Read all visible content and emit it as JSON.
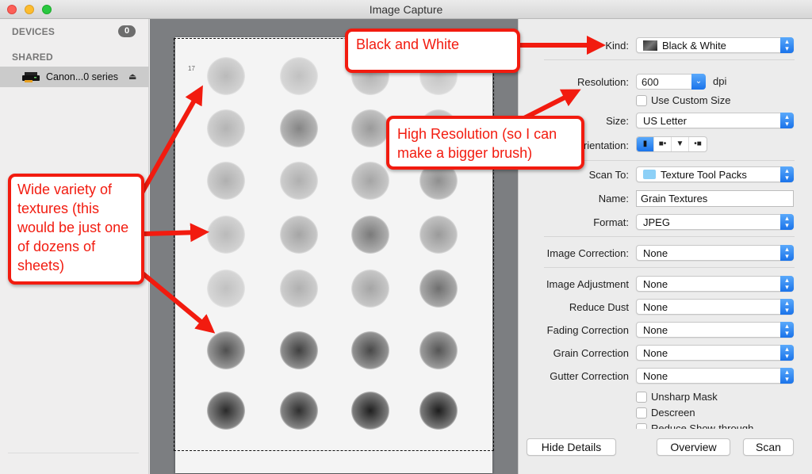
{
  "window": {
    "title": "Image Capture"
  },
  "sidebar": {
    "devices_header": "DEVICES",
    "devices_count": "0",
    "shared_header": "SHARED",
    "shared_items": [
      {
        "label": "Canon...0 series",
        "icon": "printer-icon",
        "eject_icon": "eject-icon"
      }
    ]
  },
  "preview": {
    "page_marker": "17"
  },
  "settings": {
    "kind": {
      "label": "Kind:",
      "value": "Black & White"
    },
    "resolution": {
      "label": "Resolution:",
      "value": "600",
      "unit": "dpi"
    },
    "custom_size": {
      "label": "Use Custom Size",
      "checked": false
    },
    "size": {
      "label": "Size:",
      "value": "US Letter"
    },
    "orientation": {
      "label": "Orientation:",
      "label_visible": "ientation:",
      "options": [
        "portrait",
        "rotate-right",
        "upside-down",
        "rotate-left"
      ],
      "selected": "portrait"
    },
    "scan_to": {
      "label": "Scan To:",
      "value": "Texture Tool Packs"
    },
    "name": {
      "label": "Name:",
      "value": "Grain Textures"
    },
    "format": {
      "label": "Format:",
      "value": "JPEG"
    },
    "image_correction": {
      "label": "Image Correction:",
      "value": "None"
    },
    "image_adjustment": {
      "label": "Image Adjustment",
      "value": "None"
    },
    "reduce_dust": {
      "label": "Reduce Dust",
      "value": "None"
    },
    "fading_correction": {
      "label": "Fading Correction",
      "value": "None"
    },
    "grain_correction": {
      "label": "Grain Correction",
      "value": "None"
    },
    "gutter_correction": {
      "label": "Gutter Correction",
      "value": "None"
    },
    "unsharp_mask": {
      "label": "Unsharp Mask",
      "checked": false
    },
    "descreen": {
      "label": "Descreen",
      "checked": false
    },
    "reduce_show_through": {
      "label": "Reduce Show-through",
      "checked": false
    }
  },
  "buttons": {
    "hide_details": "Hide Details",
    "overview": "Overview",
    "scan": "Scan"
  },
  "annotations": {
    "bw": "Black and White",
    "resolution": "High Resolution (so I can make a bigger brush)",
    "textures": "Wide variety of textures (this would be just one of dozens of sheets)",
    "color": "#f21b0f"
  }
}
